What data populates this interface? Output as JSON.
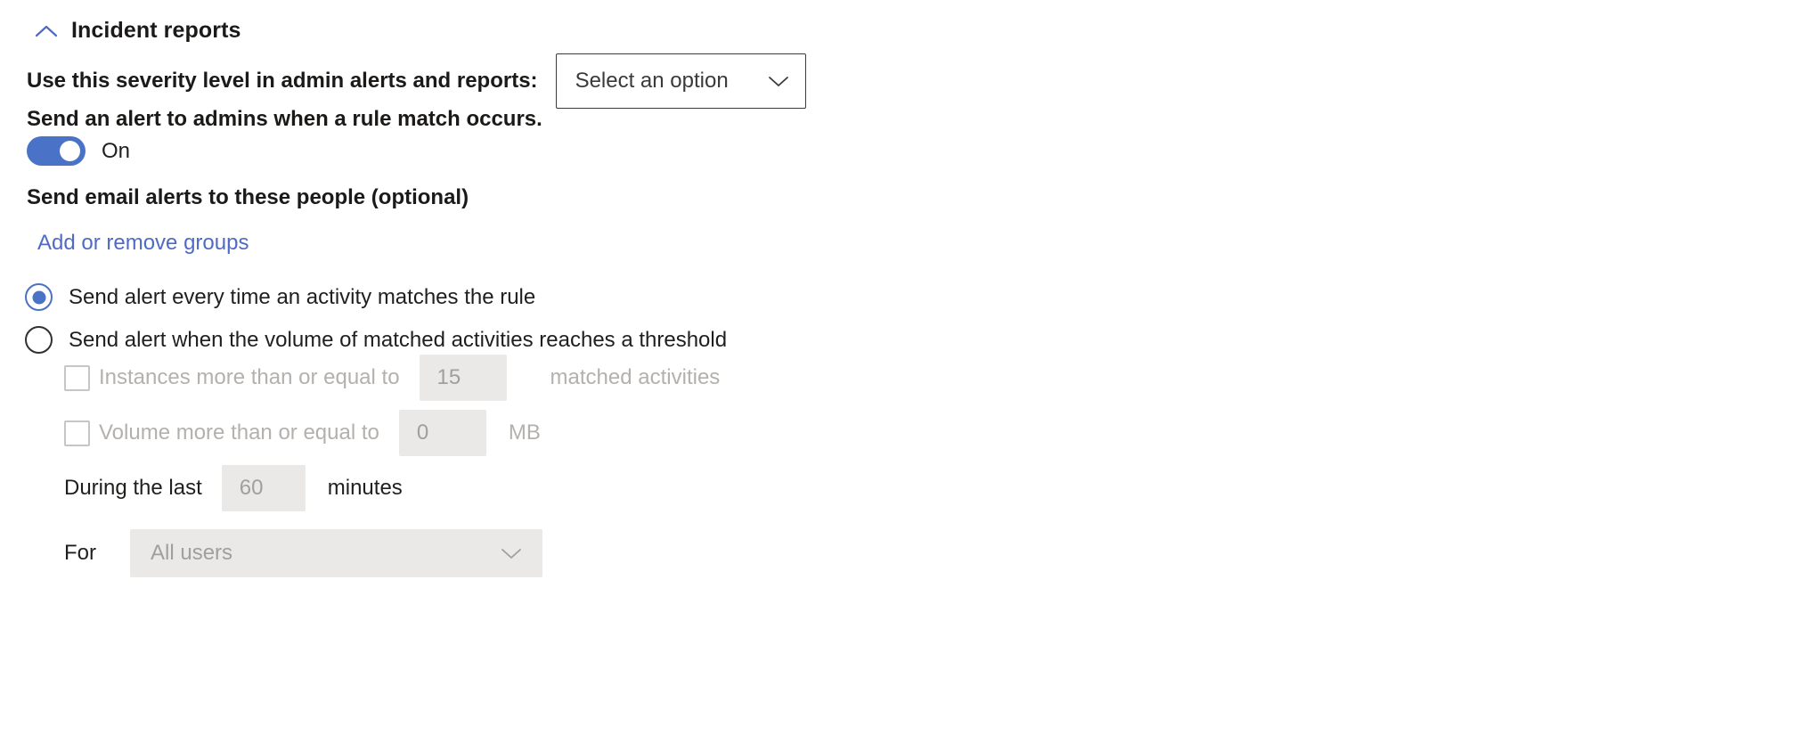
{
  "section": {
    "title": "Incident reports",
    "collapse_icon": "chevron-up-icon",
    "accent_color": "#4f6bc6"
  },
  "severity": {
    "label": "Use this severity level in admin alerts and reports:",
    "select_value": "Select an option",
    "select_icon": "chevron-down-icon"
  },
  "admin_alert": {
    "label": "Send an alert to admins when a rule match occurs.",
    "toggle_state": "On",
    "toggle_on": true,
    "toggle_color": "#4a73c8"
  },
  "email_alerts": {
    "label": "Send email alerts to these people (optional)",
    "link_label": "Add or remove groups",
    "link_color": "#4f6bc6"
  },
  "alert_mode": {
    "options": [
      {
        "label": "Send alert every time an activity matches the rule",
        "selected": true
      },
      {
        "label": "Send alert when the volume of matched activities reaches a threshold",
        "selected": false
      }
    ]
  },
  "threshold": {
    "disabled": true,
    "instances": {
      "checkbox_checked": false,
      "label": "Instances more than or equal to",
      "value": "15",
      "unit": "matched activities"
    },
    "volume": {
      "checkbox_checked": false,
      "label": "Volume more than or equal to",
      "value": "0",
      "unit": "MB"
    },
    "during": {
      "label": "During the last",
      "value": "60",
      "unit": "minutes"
    },
    "for": {
      "label": "For",
      "select_value": "All users",
      "select_icon": "chevron-down-icon"
    }
  }
}
